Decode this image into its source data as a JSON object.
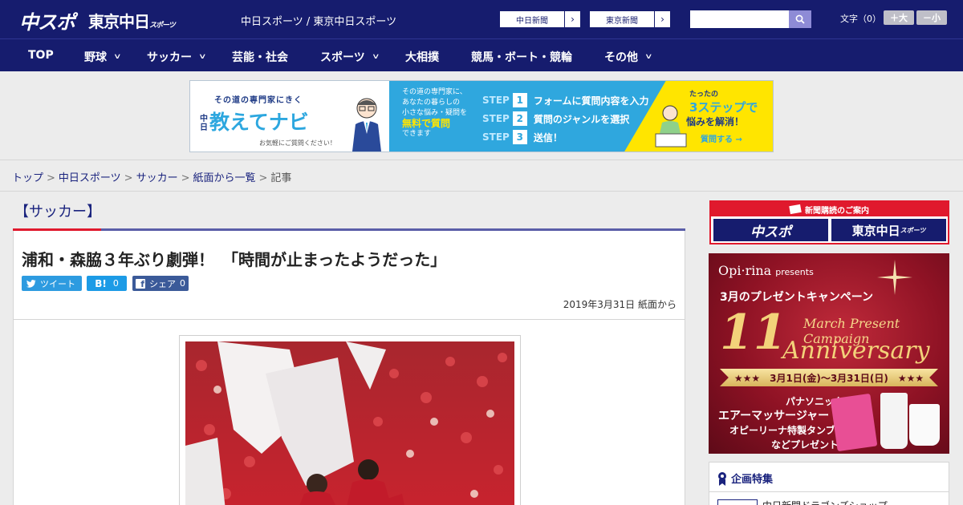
{
  "header": {
    "logo_main": "中スポ",
    "logo_tokyo": "東京中日",
    "logo_tokyo_small": "スポーツ",
    "site_name": "中日スポーツ / 東京中日スポーツ",
    "paper_links": [
      "中日新聞",
      "東京新聞"
    ],
    "search": {
      "placeholder": ""
    },
    "fontsize_label": "文字（0）",
    "fontsize_up": "＋大",
    "fontsize_down": "－小"
  },
  "nav": {
    "items": [
      {
        "label": "TOP"
      },
      {
        "label": "野球",
        "chevron": "∨"
      },
      {
        "label": "サッカー",
        "chevron": "∨"
      },
      {
        "label": "芸能・社会"
      },
      {
        "label": "スポーツ",
        "chevron": "∨"
      },
      {
        "label": "大相撲"
      },
      {
        "label": "競馬・ボート・競輪"
      },
      {
        "label": "その他",
        "chevron": "∨"
      }
    ]
  },
  "banner": {
    "subtitle": "その道の専門家にきく",
    "title_chars": "中日",
    "title": "教えてナビ",
    "note": "お気軽にご質問ください！",
    "desc_1": "その道の専門家に、",
    "desc_2": "あなたの暮らしの",
    "desc_3": "小さな悩み・疑問を",
    "desc_hl": "無料で質問",
    "desc_4": "できます",
    "step_word": "STEP",
    "steps": [
      {
        "num": "1",
        "text": "フォームに質問内容を入力"
      },
      {
        "num": "2",
        "text": "質問のジャンルを選択"
      },
      {
        "num": "3",
        "text": "送信！"
      }
    ],
    "right_1": "たったの",
    "right_2": "3ステップで",
    "right_3": "悩みを解消！",
    "right_4": "質問する →"
  },
  "breadcrumb": {
    "items": [
      "トップ",
      "中日スポーツ",
      "サッカー",
      "紙面から一覧"
    ],
    "current": "記事",
    "sep": ">"
  },
  "article": {
    "category": "【サッカー】",
    "title": "浦和・森脇３年ぶり劇弾！　「時間が止まったようだった」",
    "tweet_label": "ツイート",
    "hatena_label": "B!",
    "hatena_count": "0",
    "share_label": "シェア",
    "share_count": "0",
    "date": "2019年3月31日 紙面から"
  },
  "sidebar": {
    "subscribe_head": "新聞購読のご案内",
    "subscribe_logo_1": "中スポ",
    "subscribe_logo_2": "東京中日",
    "subscribe_logo_2_small": "スポーツ",
    "promo_brand": "Opi·rina",
    "promo_brand_small": "presents",
    "promo_campaign": "3月のプレゼントキャンペーン",
    "promo_mpc": "March Present Campaign",
    "promo_11": "11",
    "promo_anniv": "Anniversary",
    "promo_dates": "★★★　3月1日(金)〜3月31日(日)　★★★",
    "promo_prize_1": "パナソニック",
    "promo_prize_2": "エアーマッサージャー",
    "promo_prize_3": "オピーリーナ特製タンブラー",
    "promo_prize_4": "などプレゼント!",
    "feature_head": "企画特集",
    "feature_item": "中日新聞ドラゴンズショップ"
  },
  "colors": {
    "navy": "#161c6e",
    "accent_red": "#e0192d",
    "link": "#1a237e",
    "twitter": "#2d9be0",
    "hatena": "#1c9be6",
    "facebook": "#3b5a99"
  }
}
